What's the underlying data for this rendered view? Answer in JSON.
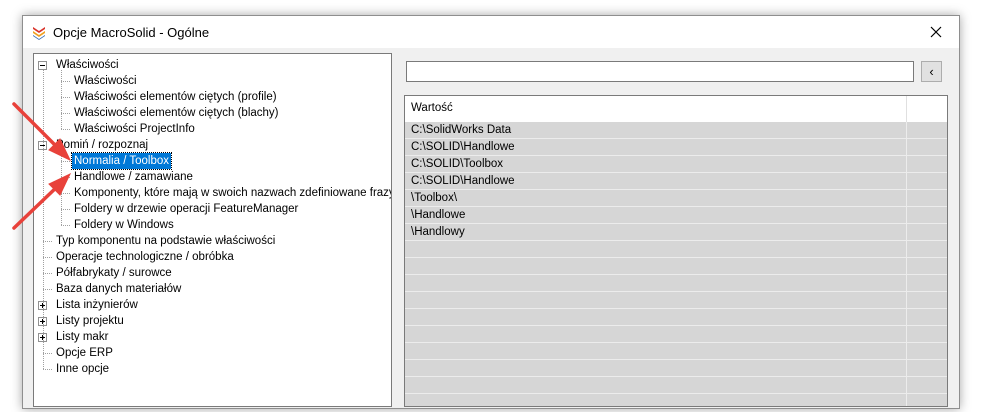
{
  "window": {
    "title": "Opcje MacroSolid - Ogólne"
  },
  "tree": {
    "items": [
      {
        "label": "Właściwości",
        "level": 0,
        "expander": "minus"
      },
      {
        "label": "Właściwości",
        "level": 1
      },
      {
        "label": "Właściwości elementów ciętych (profile)",
        "level": 1
      },
      {
        "label": "Właściwości elementów ciętych (blachy)",
        "level": 1
      },
      {
        "label": "Właściwości ProjectInfo",
        "level": 1
      },
      {
        "label": "Pomiń / rozpoznaj",
        "level": 0,
        "expander": "minus"
      },
      {
        "label": "Normalia / Toolbox",
        "level": 1,
        "selected": true
      },
      {
        "label": "Handlowe / zamawiane",
        "level": 1
      },
      {
        "label": "Komponenty, które mają w swoich nazwach zdefiniowane frazy",
        "level": 1
      },
      {
        "label": "Foldery w drzewie operacji FeatureManager",
        "level": 1
      },
      {
        "label": "Foldery w Windows",
        "level": 1
      },
      {
        "label": "Typ komponentu na podstawie właściwości",
        "level": 0
      },
      {
        "label": "Operacje technologiczne / obróbka",
        "level": 0
      },
      {
        "label": "Półfabrykaty / surowce",
        "level": 0
      },
      {
        "label": "Baza danych materiałów",
        "level": 0
      },
      {
        "label": "Lista inżynierów",
        "level": 0,
        "expander": "plus"
      },
      {
        "label": "Listy projektu",
        "level": 0,
        "expander": "plus"
      },
      {
        "label": "Listy makr",
        "level": 0,
        "expander": "plus"
      },
      {
        "label": "Opcje ERP",
        "level": 0
      },
      {
        "label": "Inne opcje",
        "level": 0
      }
    ]
  },
  "search": {
    "value": "",
    "button_label": "‹"
  },
  "grid": {
    "header": "Wartość",
    "rows": [
      "C:\\SolidWorks Data",
      "C:\\SOLID\\Handlowe",
      "C:\\SOLID\\Toolbox",
      "C:\\SOLID\\Handlowe",
      "\\Toolbox\\",
      "\\Handlowe",
      "\\Handlowy",
      "",
      "",
      "",
      "",
      "",
      "",
      "",
      "",
      "",
      ""
    ]
  },
  "colors": {
    "selection": "#0078d7",
    "annotation_arrow": "#e8413a",
    "grid_row": "#d6d6d6"
  },
  "icons": {
    "app": "macrosolid-logo-icon",
    "close": "close-icon",
    "annotation": "red-arrow-icon"
  }
}
